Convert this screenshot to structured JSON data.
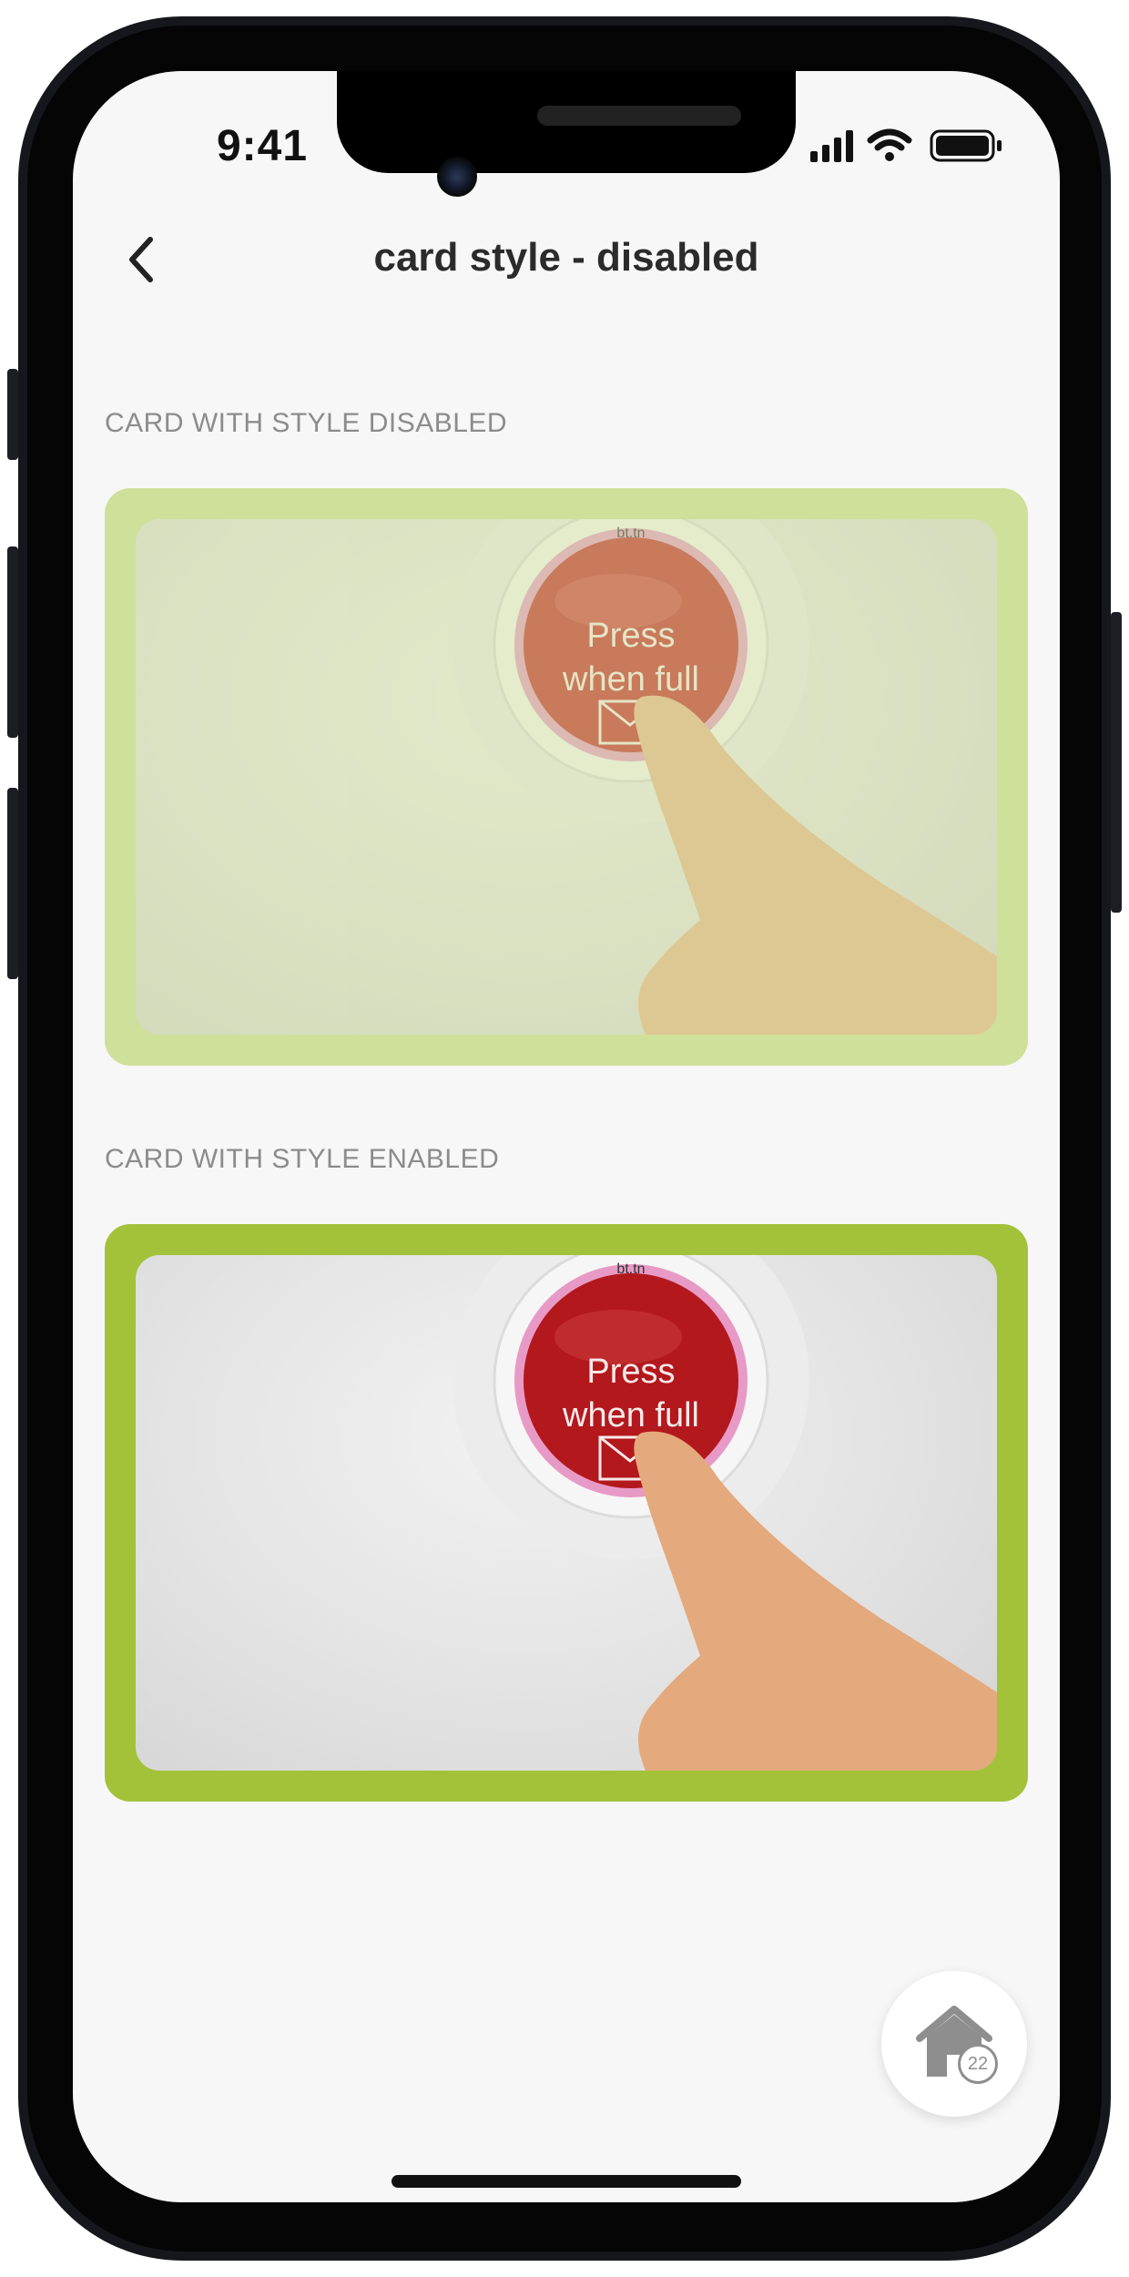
{
  "status_bar": {
    "time": "9:41"
  },
  "header": {
    "title": "card style - disabled",
    "back_icon": "chevron-left-icon"
  },
  "sections": [
    {
      "label": "CARD WITH STYLE DISABLED",
      "card": {
        "style": "disabled",
        "border_color": "#cfe09a",
        "image_text_line1": "Press",
        "image_text_line2": "when full",
        "image_brand": "bt.tn"
      }
    },
    {
      "label": "CARD WITH STYLE ENABLED",
      "card": {
        "style": "enabled",
        "border_color": "#a3c23a",
        "image_text_line1": "Press",
        "image_text_line2": "when full",
        "image_brand": "bt.tn"
      }
    }
  ],
  "fab": {
    "icon": "home-icon",
    "badge": "22"
  }
}
